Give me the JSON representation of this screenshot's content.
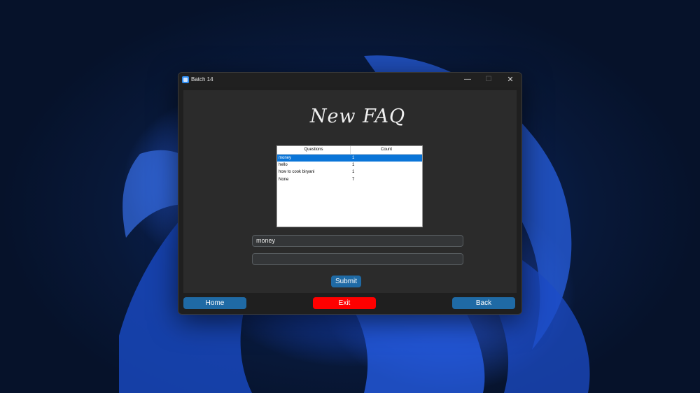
{
  "window": {
    "title": "Batch 14",
    "controls": {
      "minimize": "—",
      "maximize": "☐",
      "close": "✕"
    }
  },
  "page": {
    "title": "New FAQ"
  },
  "table": {
    "headers": [
      "Questions",
      "Count"
    ],
    "rows": [
      {
        "question": "money",
        "count": "1",
        "selected": true
      },
      {
        "question": "hello",
        "count": "1",
        "selected": false
      },
      {
        "question": "how to cook biryani",
        "count": "1",
        "selected": false
      },
      {
        "question": "None",
        "count": "7",
        "selected": false
      }
    ]
  },
  "form": {
    "question_value": "money",
    "answer_value": "",
    "submit_label": "Submit"
  },
  "nav": {
    "home_label": "Home",
    "exit_label": "Exit",
    "back_label": "Back"
  },
  "colors": {
    "accent": "#1f6aa5",
    "danger": "#ff0000",
    "selection": "#0a75d8"
  }
}
